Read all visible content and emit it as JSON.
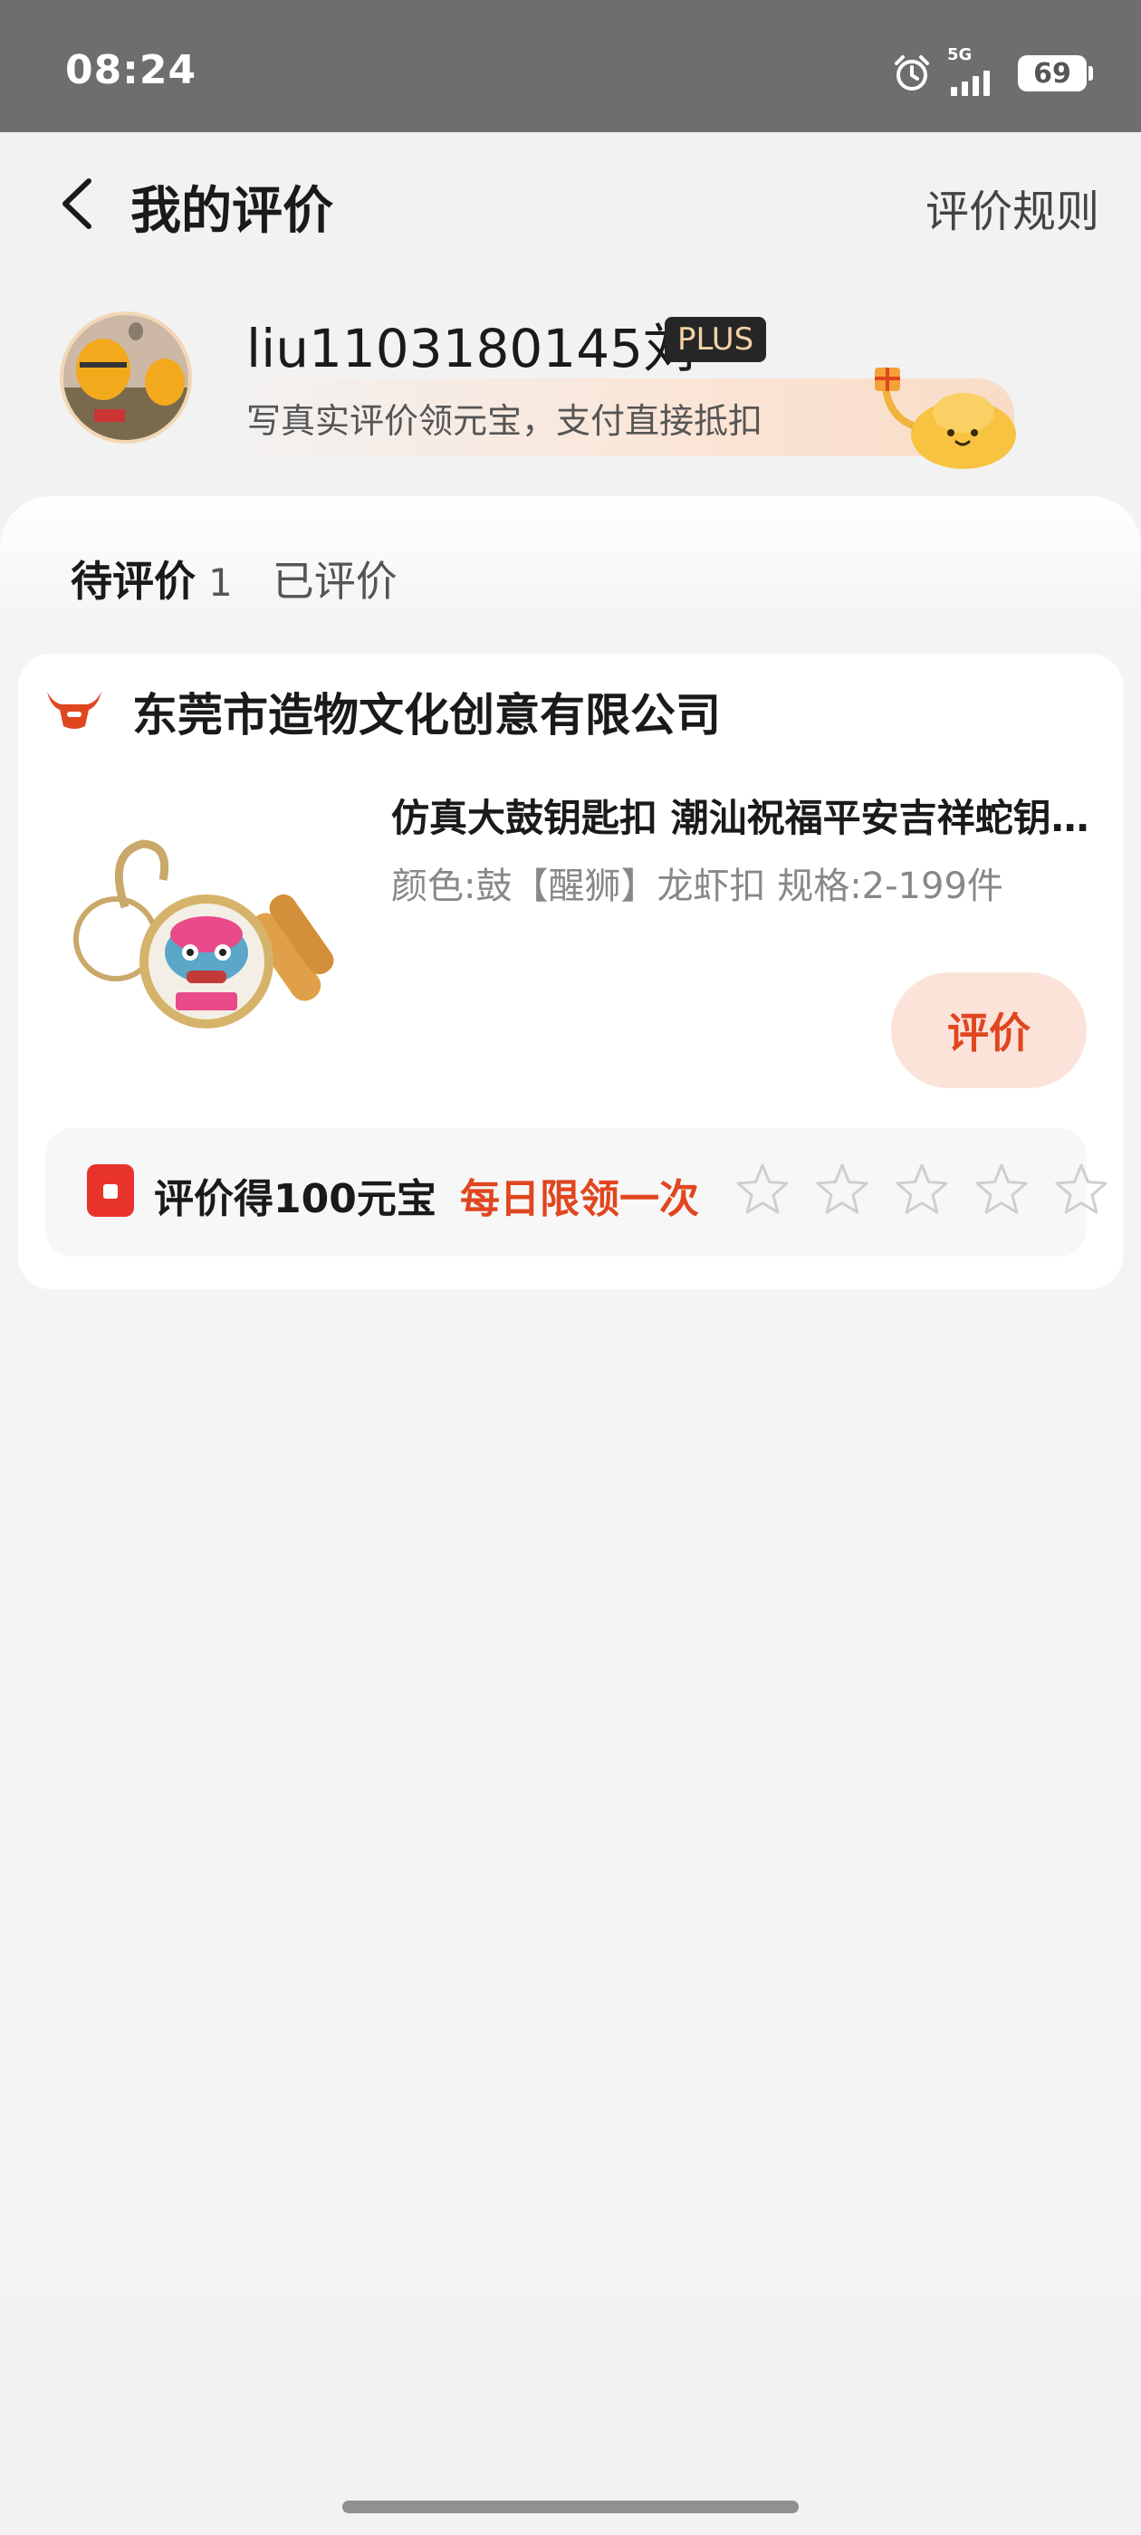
{
  "status_bar": {
    "time": "08:24",
    "network": "5G",
    "battery": "69"
  },
  "header": {
    "title": "我的评价",
    "rules_link": "评价规则"
  },
  "profile": {
    "username": "liu1103180145刘",
    "badge": "PLUS",
    "promo": "写真实评价领元宝，支付直接抵扣"
  },
  "tabs": [
    {
      "label": "待评价",
      "count": "1"
    },
    {
      "label": "已评价"
    }
  ],
  "order": {
    "shop_name": "东莞市造物文化创意有限公司",
    "product_title": "仿真大鼓钥匙扣 潮汕祝福平安吉祥蛇钥匙扣",
    "product_spec": "颜色:鼓【醒狮】龙虾扣 规格:2-199件",
    "review_button": "评价",
    "reward_text": "评价得100元宝",
    "reward_limit": "每日限领一次",
    "rating": {
      "max": 5,
      "value": 0
    }
  },
  "colors": {
    "accent": "#e0461f",
    "accent_bg": "#fbe3da",
    "status_bar": "#6e6e6e"
  }
}
